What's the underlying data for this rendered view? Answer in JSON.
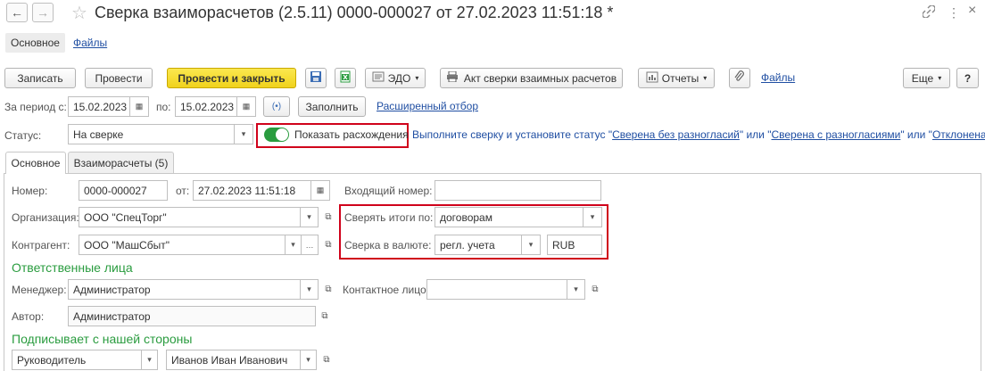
{
  "window": {
    "title": "Сверка взаиморасчетов (2.5.11) 0000-000027 от 27.02.2023 11:51:18 *",
    "back_glyph": "←",
    "forward_glyph": "→",
    "star_glyph": "☆",
    "link_glyph": "🔗",
    "menu_glyph": "⋮",
    "close_glyph": "×"
  },
  "top_tabs": {
    "main": "Основное",
    "files": "Файлы"
  },
  "toolbar": {
    "save": "Записать",
    "post": "Провести",
    "post_close": "Провести и закрыть",
    "edo": "ЭДО",
    "act": "Акт сверки взаимных расчетов",
    "reports": "Отчеты",
    "files": "Файлы",
    "more": "Еще",
    "help": "?"
  },
  "period": {
    "from_label": "За период с:",
    "from_value": "15.02.2023",
    "to_label": "по:",
    "to_value": "15.02.2023",
    "fill_button": "Заполнить",
    "advanced_filter": "Расширенный отбор"
  },
  "status": {
    "label": "Статус:",
    "value": "На сверке",
    "toggle_label": "Показать расхождения",
    "hint_prefix": "Выполните сверку и установите статус \"",
    "link1": "Сверена без разногласий",
    "hint_mid1": "\" или \"",
    "link2": "Сверена с разногласиями",
    "hint_mid2": "\" или \"",
    "link3": "Отклонена",
    "hint_suffix": "\""
  },
  "inner_tabs": {
    "main": "Основное",
    "settlements": "Взаиморасчеты (5)"
  },
  "form": {
    "number_label": "Номер:",
    "number_value": "0000-000027",
    "date_label": "от:",
    "date_value": "27.02.2023 11:51:18",
    "incoming_label": "Входящий номер:",
    "incoming_value": "",
    "org_label": "Организация:",
    "org_value": "ООО \"СпецТорг\"",
    "reconcile_by_label": "Сверять итоги по:",
    "reconcile_by_value": "договорам",
    "counterparty_label": "Контрагент:",
    "counterparty_value": "ООО \"МашСбыт\"",
    "currency_label": "Сверка в валюте:",
    "currency_value": "регл. учета",
    "currency_code": "RUB",
    "responsible_title": "Ответственные лица",
    "manager_label": "Менеджер:",
    "manager_value": "Администратор",
    "contact_label": "Контактное лицо:",
    "contact_value": "",
    "author_label": "Автор:",
    "author_value": "Администратор",
    "signer_title": "Подписывает с нашей стороны",
    "signer_role": "Руководитель",
    "signer_name": "Иванов Иван Иванович"
  },
  "colors": {
    "accent_green": "#2a9c3f",
    "highlight_red": "#d0021b",
    "primary_yellow": "#f0d21c",
    "link_blue": "#1f4ea2"
  },
  "icons": [
    "back-arrow-icon",
    "forward-arrow-icon",
    "favorite-star-icon",
    "link-icon",
    "more-menu-icon",
    "close-icon",
    "save-disk-icon",
    "excel-icon",
    "edo-icon",
    "print-icon",
    "report-icon",
    "paperclip-icon",
    "calendar-icon",
    "dropdown-arrow-icon",
    "open-form-icon",
    "period-select-icon"
  ]
}
